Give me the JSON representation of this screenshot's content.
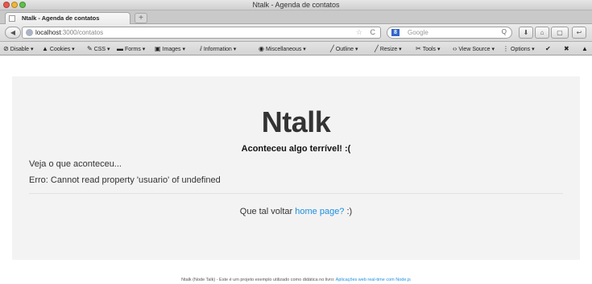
{
  "window": {
    "title": "Ntalk - Agenda de contatos"
  },
  "tab": {
    "label": "Ntalk - Agenda de contatos",
    "close": "×",
    "new_tab": "+"
  },
  "nav": {
    "back": "◀",
    "url_host": "localhost",
    "url_path": ":3000/contatos",
    "star": "☆",
    "reload": "C",
    "search_engine": "8",
    "search_placeholder": "Google",
    "search_icon": "Q",
    "download": "⬇",
    "home": "⌂",
    "view": "▢",
    "extra": "↩"
  },
  "devbar": {
    "items": [
      {
        "icon": "⊘",
        "label": "Disable"
      },
      {
        "icon": "▲",
        "label": "Cookies"
      },
      {
        "icon": "✎",
        "label": "CSS"
      },
      {
        "icon": "▬",
        "label": "Forms"
      },
      {
        "icon": "▣",
        "label": "Images"
      },
      {
        "icon": "ⅈ",
        "label": "Information"
      },
      {
        "icon": "◉",
        "label": "Miscellaneous"
      },
      {
        "icon": "╱",
        "label": "Outline"
      },
      {
        "icon": "╱",
        "label": "Resize"
      },
      {
        "icon": "✂",
        "label": "Tools"
      },
      {
        "icon": "‹›",
        "label": "View Source"
      },
      {
        "icon": "⋮",
        "label": "Options"
      }
    ],
    "check": "✔",
    "close": "✖",
    "warning": "▲"
  },
  "content": {
    "brand": "Ntalk",
    "subtitle": "Aconteceu algo terrível! :(",
    "lead": "Veja o que aconteceu...",
    "error": "Erro: Cannot read property 'usuario' of undefined",
    "return_prefix": "Que tal voltar ",
    "return_link": "home page?",
    "return_suffix": " :)"
  },
  "footer": {
    "text": "Ntalk (Node Talk) - Este é um projeto exemplo utilizado como didática no livro: ",
    "link": "Aplicações web real-time com Node.js"
  }
}
